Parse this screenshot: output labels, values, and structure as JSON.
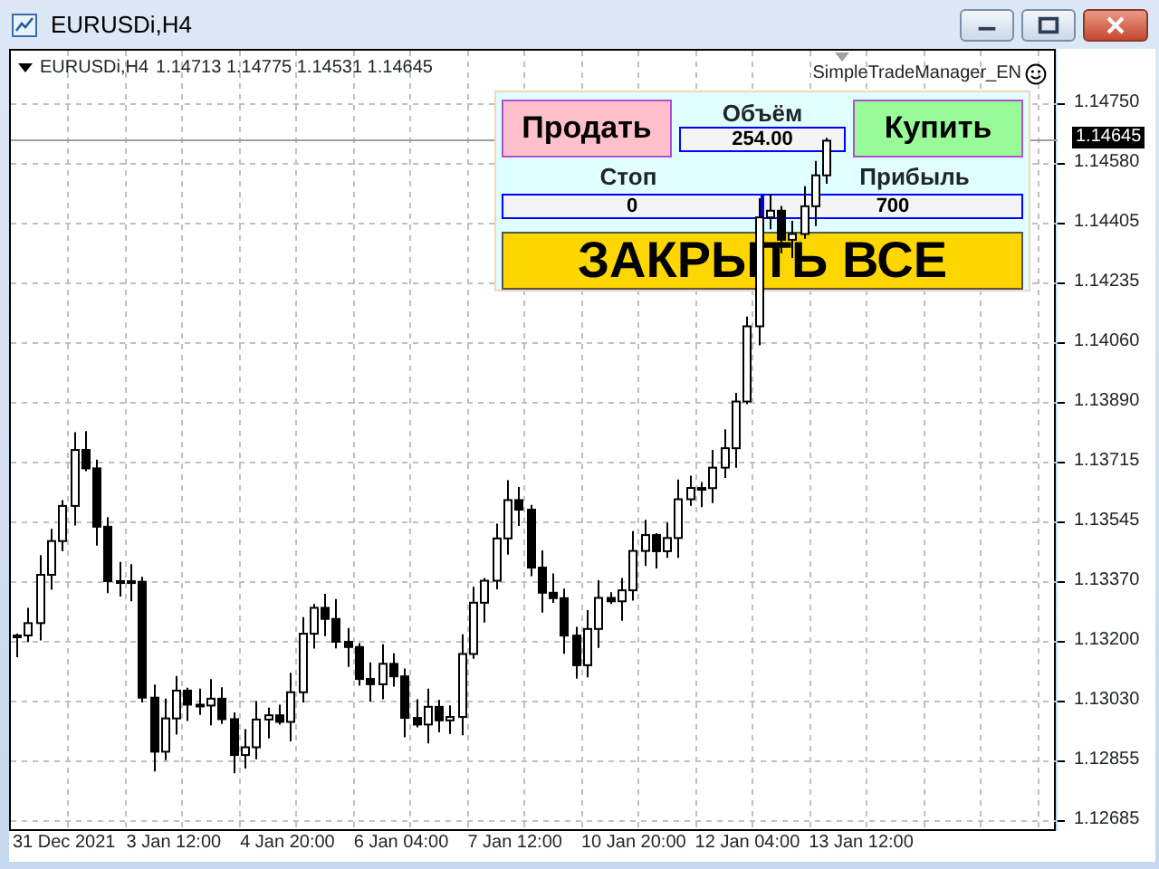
{
  "window": {
    "title": "EURUSDi,H4"
  },
  "chart": {
    "symbol": "EURUSDi,H4",
    "ohlc": "1.14713 1.14775 1.14531 1.14645",
    "indicator": "SimpleTradeManager_EN",
    "current_price": "1.14645",
    "price_labels": [
      "1.14750",
      "1.14580",
      "1.14405",
      "1.14235",
      "1.14060",
      "1.13890",
      "1.13715",
      "1.13545",
      "1.13370",
      "1.13200",
      "1.13030",
      "1.12855",
      "1.12685"
    ],
    "time_labels": [
      "31 Dec 2021",
      "3 Jan 12:00",
      "4 Jan 20:00",
      "6 Jan 04:00",
      "7 Jan 12:00",
      "10 Jan 20:00",
      "12 Jan 04:00",
      "13 Jan 12:00"
    ]
  },
  "panel": {
    "sell": "Продать",
    "volume_label": "Объём",
    "volume": "254.00",
    "buy": "Купить",
    "stop_label": "Стоп",
    "stop": "0",
    "profit_label": "Прибыль",
    "profit": "700",
    "close_all": "ЗАКРЫТЬ ВСЕ"
  }
}
